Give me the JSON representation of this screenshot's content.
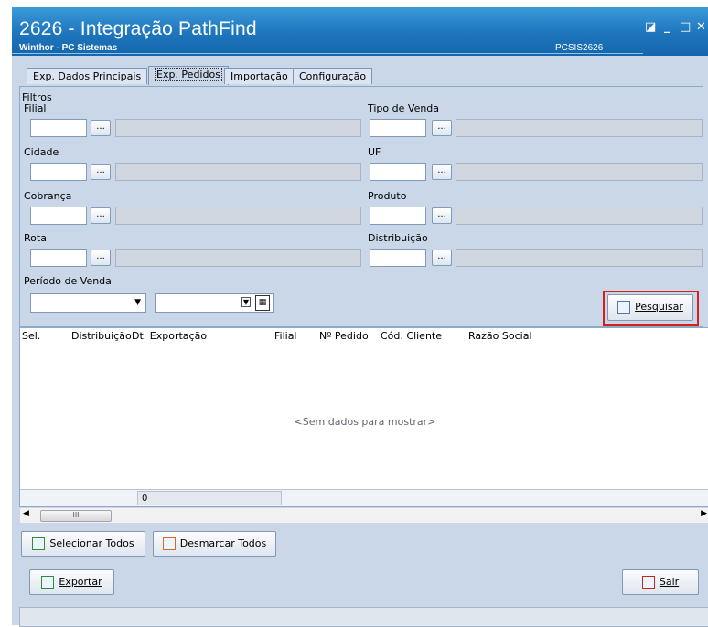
{
  "window": {
    "title": "2626 - Integração PathFind",
    "subtitle": "Winthor - PC Sistemas",
    "code": "PCSIS2626",
    "buttons": [
      "◪",
      "_",
      "□",
      "✕"
    ]
  },
  "tabs": [
    {
      "label": "Exp. Dados Principais",
      "active": false
    },
    {
      "label": "Exp. Pedidos",
      "active": true
    },
    {
      "label": "Importação",
      "active": false
    },
    {
      "label": "Configuração",
      "active": false
    }
  ],
  "filters": {
    "legend": "Filtros",
    "filial": {
      "label": "Filial",
      "value": ""
    },
    "tipo_venda": {
      "label": "Tipo de Venda",
      "value": ""
    },
    "cidade": {
      "label": "Cidade",
      "value": ""
    },
    "uf": {
      "label": "UF",
      "value": ""
    },
    "cobranca": {
      "label": "Cobrança",
      "value": ""
    },
    "produto": {
      "label": "Produto",
      "value": ""
    },
    "rota": {
      "label": "Rota",
      "value": ""
    },
    "distribuicao": {
      "label": "Distribuição",
      "value": ""
    },
    "periodo": {
      "label": "Período de Venda",
      "inicio": "",
      "fim": ""
    },
    "lookup_button": "..."
  },
  "search_button": {
    "label": "Pesquisar"
  },
  "grid": {
    "columns": [
      "Sel.",
      "Distribuição",
      "Dt. Exportação",
      "Filial",
      "Nº Pedido",
      "Cód. Cliente",
      "Razão Social"
    ],
    "empty_text": "<Sem dados para mostrar>",
    "footer_count": "0",
    "scroll_thumb": "III"
  },
  "actions": {
    "select_all": "Selecionar Todos",
    "deselect_all": "Desmarcar Todos",
    "export": "Exportar",
    "exit": "Sair"
  },
  "colors": {
    "titlebar": "#1d75bc",
    "background": "#c9d7e8",
    "highlight": "#d5201a"
  }
}
